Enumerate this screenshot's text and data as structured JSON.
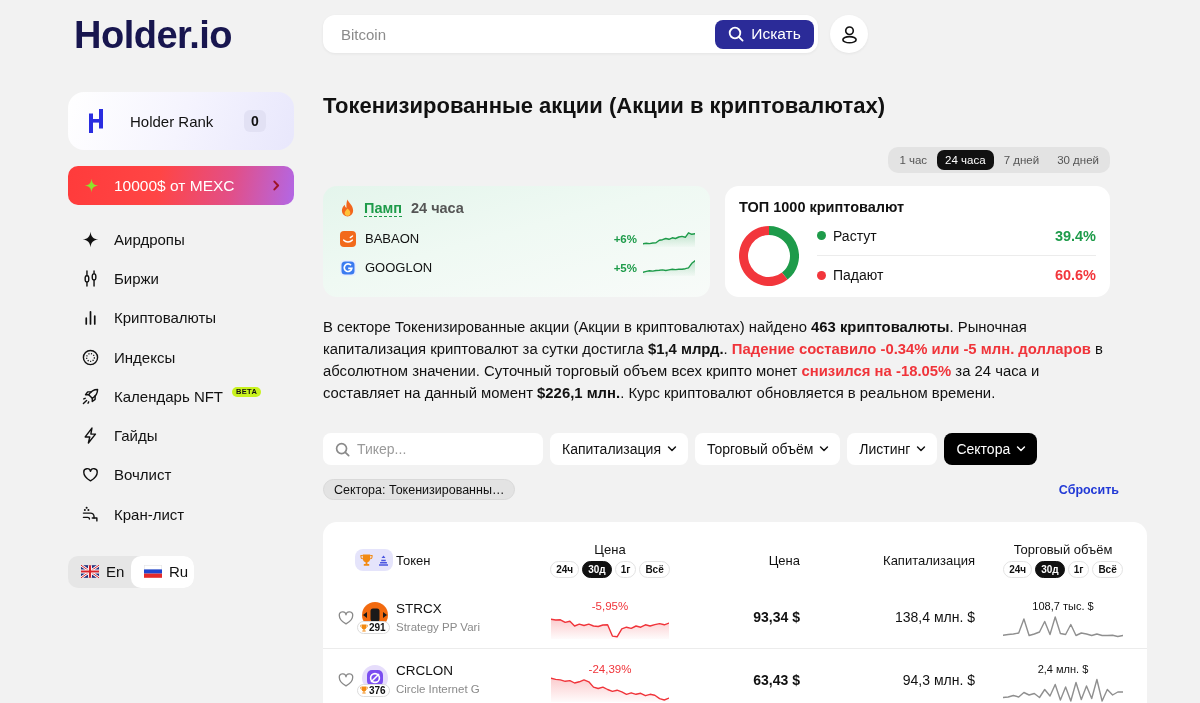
{
  "sidebar": {
    "logo": "Holder.io",
    "rank_card": {
      "label": "Holder Rank",
      "value": "0"
    },
    "promo": {
      "label": "10000$ от MEXC"
    },
    "nav": [
      {
        "label": "Аирдропы"
      },
      {
        "label": "Биржи"
      },
      {
        "label": "Криптовалюты"
      },
      {
        "label": "Индексы"
      },
      {
        "label": "Календарь NFT",
        "badge": "BETA"
      },
      {
        "label": "Гайды"
      },
      {
        "label": "Вочлист"
      },
      {
        "label": "Кран-лист"
      }
    ],
    "languages": [
      {
        "label": "En",
        "selected": false
      },
      {
        "label": "Ru",
        "selected": true
      }
    ]
  },
  "search": {
    "placeholder": "Bitcoin",
    "button": "Искать"
  },
  "title": "Токенизированные акции (Акции в криптовалютах)",
  "periods": [
    {
      "label": "1 час",
      "selected": false
    },
    {
      "label": "24 часа",
      "selected": true
    },
    {
      "label": "7 дней",
      "selected": false
    },
    {
      "label": "30 дней",
      "selected": false
    }
  ],
  "pump_card": {
    "title": "Памп",
    "period": "24 часа",
    "items": [
      {
        "name": "BABAON",
        "change": "+6%",
        "negative": false
      },
      {
        "name": "GOOGLON",
        "change": "+5%",
        "negative": false
      }
    ]
  },
  "market_card": {
    "title": "ТОП 1000 криптовалют",
    "chart_data": {
      "type": "donut",
      "values": [
        39.4,
        60.6
      ]
    },
    "legend": [
      {
        "label": "Растут",
        "value": "39.4%",
        "color": "#1e9b4a"
      },
      {
        "label": "Падают",
        "value": "60.6%",
        "color": "#f2363c"
      }
    ]
  },
  "summary": [
    {
      "text": "В секторе Токенизированные акции (Акции в криптовалютах) найдено ",
      "kind": "plain"
    },
    {
      "text": "463 криптовалюты",
      "kind": "bold"
    },
    {
      "text": ". Рыночная капитализация криптовалют за сутки достигла ",
      "kind": "plain"
    },
    {
      "text": "$1,4 млрд.",
      "kind": "bold"
    },
    {
      "text": ". ",
      "kind": "plain"
    },
    {
      "text": "Падение составило -0.34% или -5 млн. долларов",
      "kind": "down"
    },
    {
      "text": " в абсолютном значении. Суточный торговый объем всех крипто монет ",
      "kind": "plain"
    },
    {
      "text": "снизился на -18.05%",
      "kind": "down"
    },
    {
      "text": " за 24 часа и составляет на данный момент ",
      "kind": "plain"
    },
    {
      "text": "$226,1 млн.",
      "kind": "bold"
    },
    {
      "text": ". Курс криптовалют обновляется в реальном времени.",
      "kind": "plain"
    }
  ],
  "filters": {
    "search": {
      "placeholder": "Тикер..."
    },
    "dropdowns": [
      {
        "label": "Капитализация",
        "selected": false
      },
      {
        "label": "Торговый объём",
        "selected": false
      },
      {
        "label": "Листинг",
        "selected": false
      },
      {
        "label": "Сектора",
        "selected": true
      }
    ],
    "chips": [
      {
        "label": "Сектора: Токенизированны…"
      }
    ],
    "reset": "Сбросить"
  },
  "table": {
    "columns": [
      {
        "label": "Токен"
      },
      {
        "label": "Цена",
        "periods": [
          {
            "label": "24ч",
            "selected": false
          },
          {
            "label": "30д",
            "selected": true
          },
          {
            "label": "1г",
            "selected": false
          },
          {
            "label": "Всё",
            "selected": false
          }
        ]
      },
      {
        "label": "Цена"
      },
      {
        "label": "Капитализация"
      },
      {
        "label": "Торговый объём",
        "periods": [
          {
            "label": "24ч",
            "selected": false
          },
          {
            "label": "30д",
            "selected": true
          },
          {
            "label": "1г",
            "selected": false
          },
          {
            "label": "Всё",
            "selected": false
          }
        ]
      }
    ],
    "rows": [
      {
        "symbol": "STRCX",
        "name": "Strategy PP Vari",
        "rank": "291",
        "change": "-5,95%",
        "negative": true,
        "price": "93,34 $",
        "market_cap": "138,4 млн. $",
        "volume": "108,7 тыс. $"
      },
      {
        "symbol": "CRCLON",
        "name": "Circle Internet G",
        "rank": "376",
        "change": "-24,39%",
        "negative": true,
        "price": "63,43 $",
        "market_cap": "94,3 млн. $",
        "volume": "2,4 млн. $"
      }
    ]
  }
}
